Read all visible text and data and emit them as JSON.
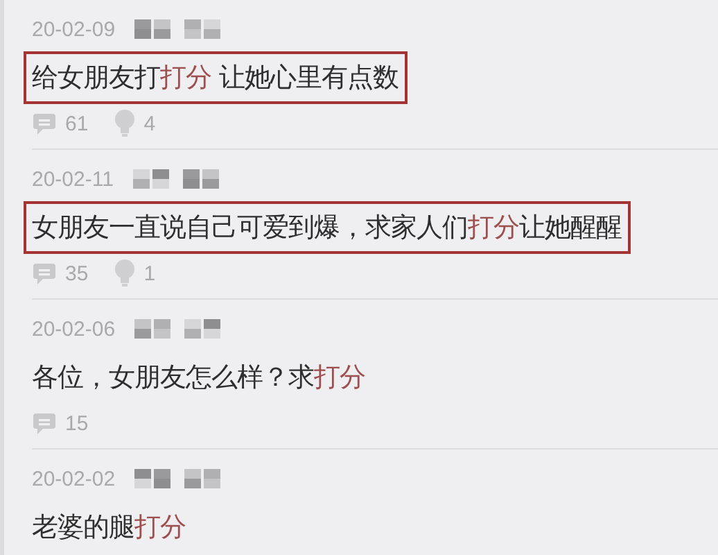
{
  "posts": [
    {
      "date": "20-02-09",
      "boxed": true,
      "title": [
        {
          "text": "给女朋友打",
          "highlight": false
        },
        {
          "text": "打分",
          "highlight": true
        },
        {
          "text": " 让她心里有点数",
          "highlight": false
        }
      ],
      "stats": [
        {
          "kind": "comments",
          "count": "61"
        },
        {
          "kind": "likes",
          "count": "4"
        }
      ]
    },
    {
      "date": "20-02-11",
      "boxed": true,
      "title": [
        {
          "text": "女朋友一直说自己可爱到爆，求家人们",
          "highlight": false
        },
        {
          "text": "打分",
          "highlight": true
        },
        {
          "text": "让她醒醒",
          "highlight": false
        }
      ],
      "stats": [
        {
          "kind": "comments",
          "count": "35"
        },
        {
          "kind": "likes",
          "count": "1"
        }
      ]
    },
    {
      "date": "20-02-06",
      "boxed": false,
      "title": [
        {
          "text": "各位，女朋友怎么样？求",
          "highlight": false
        },
        {
          "text": "打分",
          "highlight": true
        }
      ],
      "stats": [
        {
          "kind": "comments",
          "count": "15"
        }
      ]
    },
    {
      "date": "20-02-02",
      "boxed": false,
      "title": [
        {
          "text": "老婆的腿",
          "highlight": false
        },
        {
          "text": "打分",
          "highlight": true
        }
      ]
    }
  ]
}
